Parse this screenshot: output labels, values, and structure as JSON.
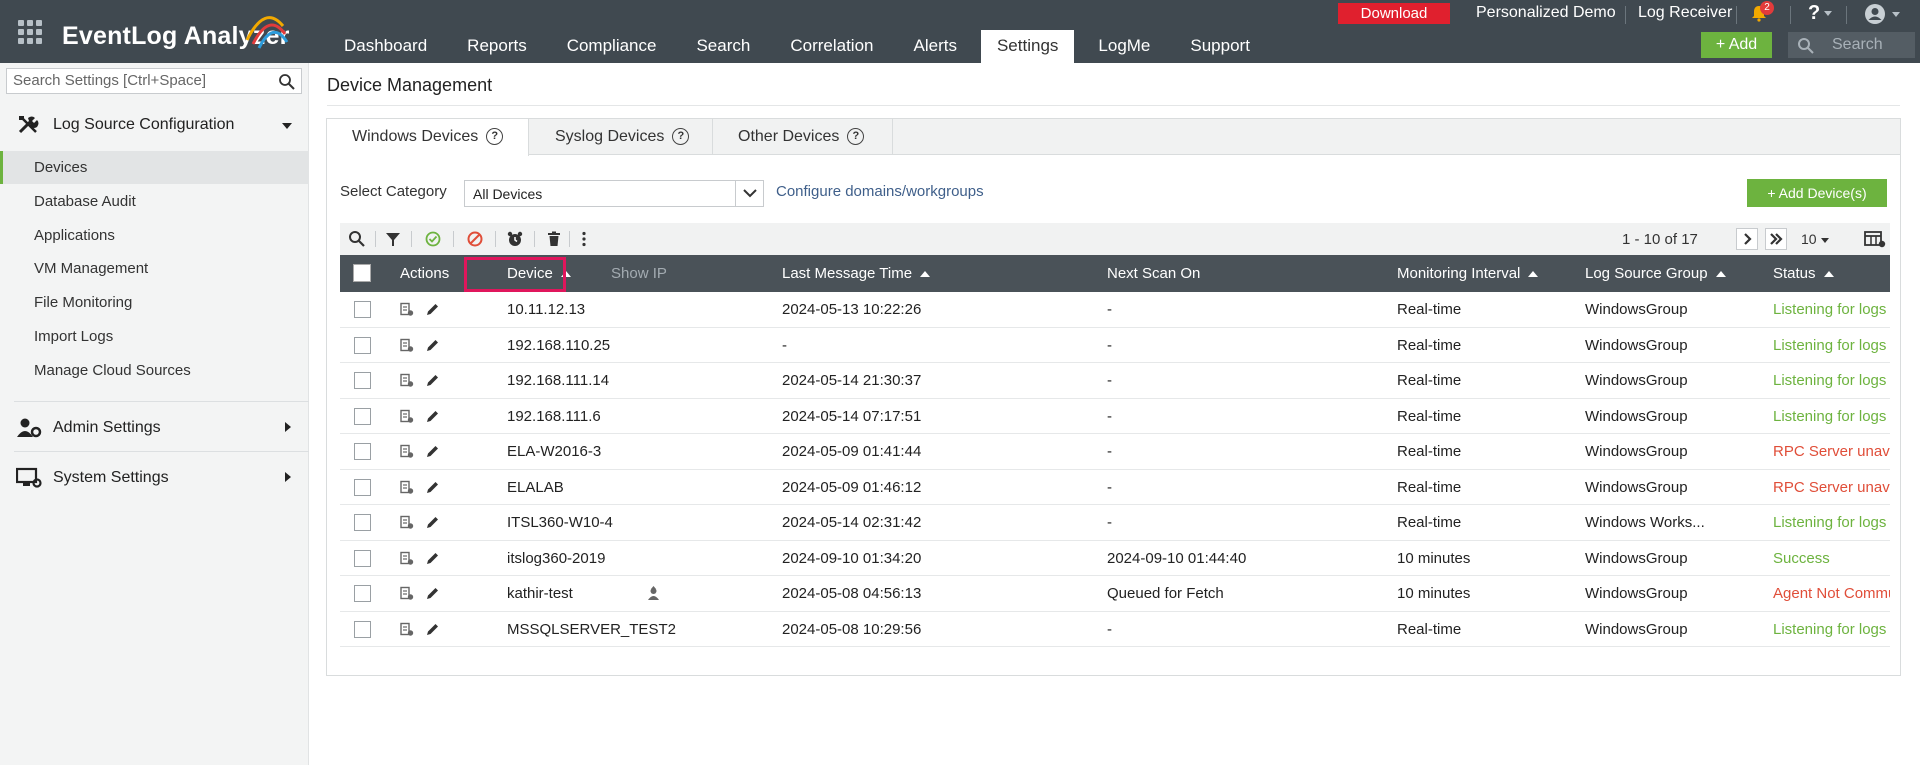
{
  "app": {
    "name": "EventLog Analyzer"
  },
  "nav": {
    "tabs": [
      "Dashboard",
      "Reports",
      "Compliance",
      "Search",
      "Correlation",
      "Alerts",
      "Settings",
      "LogMe",
      "Support"
    ],
    "active": "Settings"
  },
  "topbar": {
    "download_label": "Download",
    "personalized_demo": "Personalized Demo",
    "log_receiver": "Log Receiver",
    "notification_count": "2",
    "help_label": "?",
    "add_label": "+ Add",
    "search_placeholder": "Search"
  },
  "sidebar": {
    "search_placeholder": "Search Settings [Ctrl+Space]",
    "sections": [
      {
        "label": "Log Source Configuration",
        "icon": "tools-icon",
        "expanded": true
      },
      {
        "label": "Admin Settings",
        "icon": "users-gear-icon",
        "expanded": false
      },
      {
        "label": "System Settings",
        "icon": "monitor-gear-icon",
        "expanded": false
      }
    ],
    "items": [
      "Devices",
      "Database Audit",
      "Applications",
      "VM Management",
      "File Monitoring",
      "Import Logs",
      "Manage Cloud Sources"
    ],
    "active_item": "Devices"
  },
  "page": {
    "title": "Device Management",
    "subtabs": [
      "Windows Devices",
      "Syslog Devices",
      "Other Devices"
    ],
    "active_subtab": "Windows Devices",
    "category_label": "Select Category",
    "category_value": "All Devices",
    "configure_link": "Configure domains/workgroups",
    "add_device_label": "+ Add Device(s)",
    "pagination": "1 - 10 of 17",
    "per_page": "10"
  },
  "table": {
    "columns": [
      "Actions",
      "Device",
      "Show IP",
      "Last Message Time",
      "Next Scan On",
      "Monitoring Interval",
      "Log Source Group",
      "Status"
    ],
    "rows": [
      {
        "device": "10.11.12.13",
        "last_message": "2024-05-13 10:22:26",
        "next_scan": "-",
        "interval": "Real-time",
        "group": "WindowsGroup",
        "status": "Listening for logs",
        "status_type": "ok"
      },
      {
        "device": "192.168.110.25",
        "last_message": "-",
        "next_scan": "-",
        "interval": "Real-time",
        "group": "WindowsGroup",
        "status": "Listening for logs",
        "status_type": "ok"
      },
      {
        "device": "192.168.111.14",
        "last_message": "2024-05-14 21:30:37",
        "next_scan": "-",
        "interval": "Real-time",
        "group": "WindowsGroup",
        "status": "Listening for logs",
        "status_type": "ok"
      },
      {
        "device": "192.168.111.6",
        "last_message": "2024-05-14 07:17:51",
        "next_scan": "-",
        "interval": "Real-time",
        "group": "WindowsGroup",
        "status": "Listening for logs",
        "status_type": "ok"
      },
      {
        "device": "ELA-W2016-3",
        "last_message": "2024-05-09 01:41:44",
        "next_scan": "-",
        "interval": "Real-time",
        "group": "WindowsGroup",
        "status": "RPC Server unavailable",
        "status_type": "err"
      },
      {
        "device": "ELALAB",
        "last_message": "2024-05-09 01:46:12",
        "next_scan": "-",
        "interval": "Real-time",
        "group": "WindowsGroup",
        "status": "RPC Server unavailable",
        "status_type": "err"
      },
      {
        "device": "ITSL360-W10-4",
        "last_message": "2024-05-14 02:31:42",
        "next_scan": "-",
        "interval": "Real-time",
        "group": "Windows Works...",
        "status": "Listening for logs",
        "status_type": "ok"
      },
      {
        "device": "itslog360-2019",
        "last_message": "2024-09-10 01:34:20",
        "next_scan": "2024-09-10 01:44:40",
        "interval": "10 minutes",
        "group": "WindowsGroup",
        "status": "Success",
        "status_type": "ok"
      },
      {
        "device": "kathir-test",
        "last_message": "2024-05-08 04:56:13",
        "next_scan": "Queued for Fetch",
        "interval": "10 minutes",
        "group": "WindowsGroup",
        "status": "Agent Not Communicating",
        "status_type": "err",
        "agent": true
      },
      {
        "device": "MSSQLSERVER_TEST2",
        "last_message": "2024-05-08 10:29:56",
        "next_scan": "-",
        "interval": "Real-time",
        "group": "WindowsGroup",
        "status": "Listening for logs",
        "status_type": "ok"
      }
    ]
  },
  "colors": {
    "accent_green": "#6db33f",
    "topbar": "#404950",
    "table_header": "#4a5258",
    "error": "#e04e39",
    "highlight": "#e0165c",
    "download": "#e0202e"
  }
}
